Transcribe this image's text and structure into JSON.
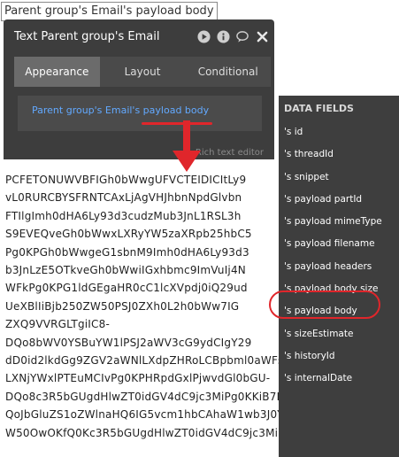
{
  "top_label": "Parent group's Email's payload body",
  "panel": {
    "title": "Text Parent group's Email",
    "tabs": [
      "Appearance",
      "Layout",
      "Conditional"
    ],
    "expression": "Parent group's Email's payload body",
    "rich_text_label": "Rich text editor",
    "icons": [
      "play-icon",
      "info-icon",
      "comment-icon",
      "close-icon"
    ]
  },
  "code_lines": [
    "PCFETONUWVBFIGh0bWwgUFVCTEIDICItLy9",
    "vL0RURCBYSFRNTCAxLjAgVHJhbnNpdGlvbn",
    "FTIlgImh0dHA6Ly93d3cudzMub3JnL1RSL3h",
    "S9EVEQveGh0bWwxLXRyYW5zaXRpb25hbC5",
    "Pg0KPGh0bWwgeG1sbnM9Imh0dHA6Ly93d3",
    "b3JnLzE5OTkveGh0bWwiIGxhbmc9ImVuIj4N",
    "WFkPg0KPG1ldGEgaHR0cC1lcXVpdj0iQ29ud",
    "UeXBlIiBjb250ZW50PSJ0ZXh0L2h0bWw7IG",
    "ZXQ9VVRGLTgiIC8-",
    "DQo8bWV0YSBuYW1lPSJ2aWV3cG9ydCIgY29",
    "dD0id2lkdGg9ZGV2aWNlLXdpZHRoLCBpbml0aWFs",
    "LXNjYWxlPTEuMCIvPg0KPHRpdGxlPjwvdGl0bGU-",
    "DQo8c3R5bGUgdHlwZT0idGV4dC9jc3MiPg0KKiB7D",
    "QoJbGluZS1oZWlnaHQ6IG5vcm1hbCAhaW1wb3J0Y",
    "W50OwOKfQ0Kc3R5bGUgdHlwZT0idGV4dC9jc3Mi"
  ],
  "data_fields": {
    "header": "DATA FIELDS",
    "items": [
      "'s id",
      "'s threadId",
      "'s snippet",
      "'s payload partId",
      "'s payload mimeType",
      "'s payload filename",
      "'s payload headers",
      "'s payload body size",
      "'s payload body",
      "'s sizeEstimate",
      "'s historyId",
      "'s internalDate"
    ]
  },
  "colors": {
    "highlight": "#e0262b",
    "link": "#62a9ff",
    "panel_bg": "#3d3d3d"
  }
}
